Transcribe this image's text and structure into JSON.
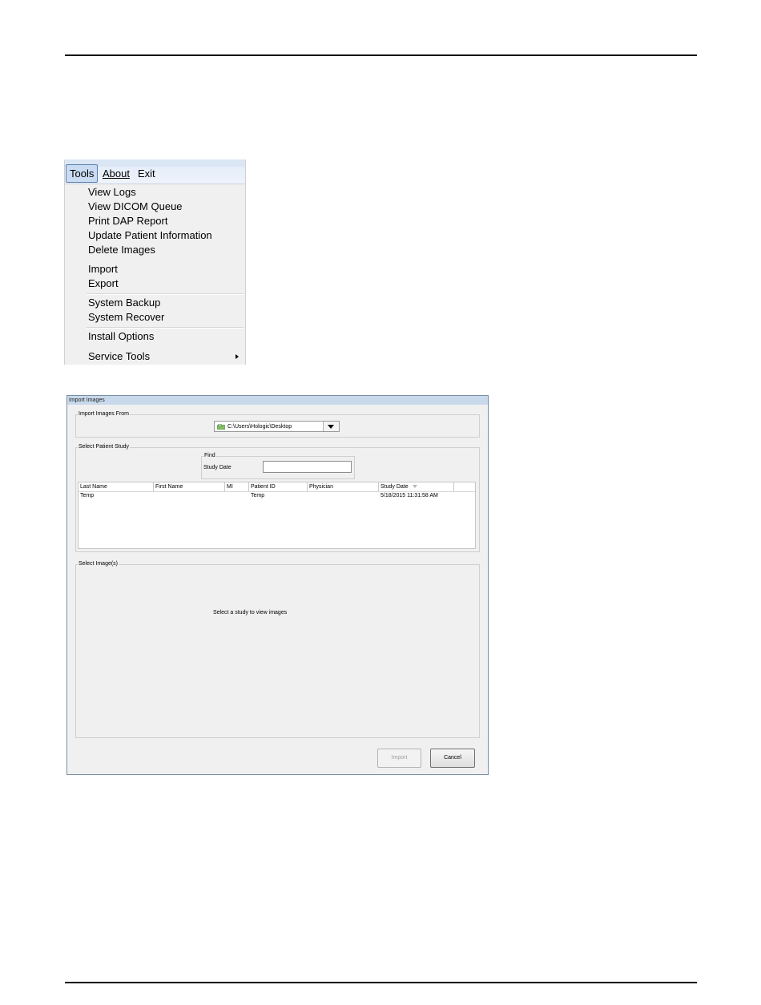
{
  "menu": {
    "bar": [
      {
        "label": "Tools",
        "active": true
      },
      {
        "label": "About",
        "active": false
      },
      {
        "label": "Exit",
        "active": false
      }
    ],
    "items": [
      "View Logs",
      "View DICOM Queue",
      "Print DAP Report",
      "Update Patient Information",
      "Delete Images",
      "Import",
      "Export",
      "System Backup",
      "System Recover",
      "Install Options",
      "Service Tools"
    ]
  },
  "dialog": {
    "title": "Import Images",
    "import_from": {
      "group_label": "Import Images From",
      "path": "C:\\Users\\Hologic\\Desktop"
    },
    "patient_study": {
      "group_label": "Select Patient Study",
      "find_label": "Find",
      "study_date_label": "Study Date",
      "study_date_value": "",
      "columns": [
        "Last Name",
        "First Name",
        "MI",
        "Patient ID",
        "Physician",
        "Study Date"
      ],
      "rows": [
        {
          "last_name": "Temp",
          "first_name": "",
          "mi": "",
          "patient_id": "Temp",
          "physician": "",
          "study_date": "5/18/2015 11:31:58 AM"
        }
      ]
    },
    "images": {
      "group_label": "Select Image(s)",
      "empty_message": "Select a study to view images"
    },
    "buttons": {
      "import": "Import",
      "cancel": "Cancel"
    }
  },
  "colors": {
    "menubar": "#dbe6f4",
    "menu_active": "#c9dcf3",
    "dialog_title": "#c9d9ec",
    "window_bg": "#f0f0f0"
  }
}
